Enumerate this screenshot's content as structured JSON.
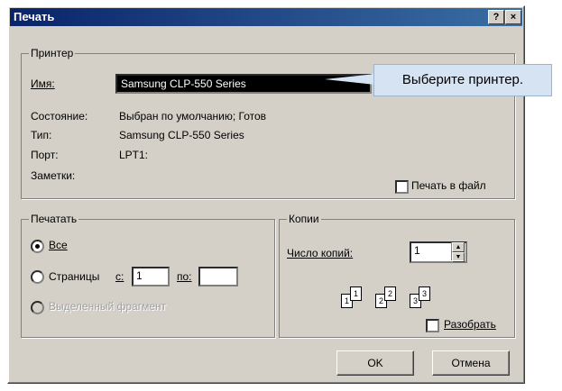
{
  "window": {
    "title": "Печать",
    "help_label": "?",
    "close_label": "×"
  },
  "printer_group": {
    "label": "Принтер",
    "name_label": "Имя:",
    "name_value": "Samsung CLP-550 Series",
    "status_label": "Состояние:",
    "status_value": "Выбран по умолчанию; Готов",
    "type_label": "Тип:",
    "type_value": "Samsung CLP-550 Series",
    "port_label": "Порт:",
    "port_value": "LPT1:",
    "notes_label": "Заметки:",
    "print_to_file_label": "Печать в файл"
  },
  "print_range": {
    "label": "Печатать",
    "all_label": "Все",
    "pages_label": "Страницы",
    "from_label": "с:",
    "from_value": "1",
    "to_label": "по:",
    "to_value": "",
    "selection_label": "Выделенный фрагмент"
  },
  "copies": {
    "label": "Копии",
    "count_label": "Число копий:",
    "count_value": "1",
    "collate_label": "Разобрать",
    "page_numbers": [
      "1",
      "1",
      "2",
      "2",
      "3",
      "3"
    ]
  },
  "buttons": {
    "ok": "OK",
    "cancel": "Отмена"
  },
  "callout": {
    "text": "Выберите принтер."
  }
}
